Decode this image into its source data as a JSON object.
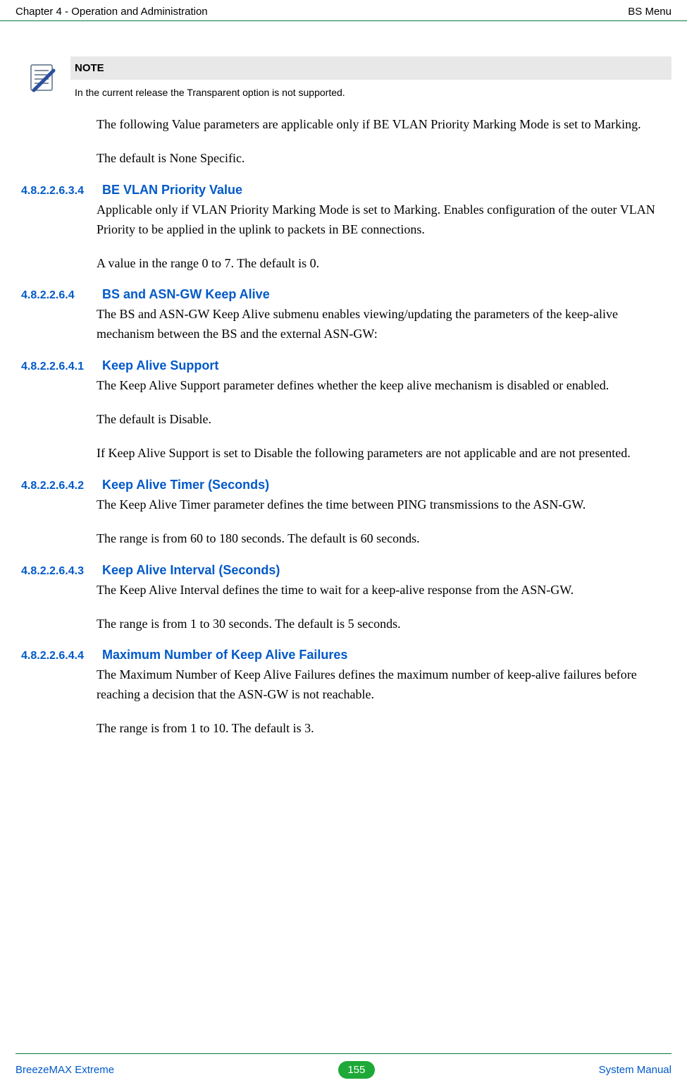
{
  "header": {
    "left": "Chapter 4 - Operation and Administration",
    "right": "BS Menu"
  },
  "note": {
    "label": "NOTE",
    "text": "In the current release the Transparent option is not supported."
  },
  "intro": [
    "The following Value parameters are applicable only if BE VLAN Priority Marking Mode is set to Marking.",
    "The default is None Specific."
  ],
  "sections": [
    {
      "num": "4.8.2.2.6.3.4",
      "title": "BE VLAN Priority Value",
      "paras": [
        "Applicable only if VLAN Priority Marking Mode is set to Marking. Enables configuration of the outer VLAN Priority to be applied in the uplink to packets in BE connections.",
        "A value in the range 0 to 7. The default is 0."
      ]
    },
    {
      "num": "4.8.2.2.6.4",
      "title": "BS and ASN-GW Keep Alive",
      "paras": [
        "The BS and ASN-GW Keep Alive submenu enables viewing/updating the parameters of the keep-alive mechanism between the BS and the external ASN-GW:"
      ]
    },
    {
      "num": "4.8.2.2.6.4.1",
      "title": "Keep Alive Support",
      "paras": [
        "The Keep Alive Support parameter defines whether the keep alive mechanism is disabled or enabled.",
        "The default is Disable.",
        "If Keep Alive Support is set to Disable the following parameters are not applicable and are not presented."
      ]
    },
    {
      "num": "4.8.2.2.6.4.2",
      "title": "Keep Alive Timer (Seconds)",
      "paras": [
        "The Keep Alive Timer parameter defines the time between PING transmissions to the ASN-GW.",
        "The range is from 60 to 180 seconds. The default is 60 seconds."
      ]
    },
    {
      "num": "4.8.2.2.6.4.3",
      "title": "Keep Alive Interval (Seconds)",
      "paras": [
        "The Keep Alive Interval defines the time to wait for a keep-alive response from the ASN-GW.",
        "The range is from 1 to 30 seconds. The default is 5 seconds."
      ]
    },
    {
      "num": "4.8.2.2.6.4.4",
      "title": "Maximum Number of Keep Alive Failures",
      "paras": [
        "The Maximum Number of Keep Alive Failures defines the maximum number of keep-alive failures before reaching a decision that the ASN-GW is not reachable.",
        "The range is from 1 to 10. The default is 3."
      ]
    }
  ],
  "footer": {
    "left": "BreezeMAX Extreme",
    "page": "155",
    "right": "System Manual"
  }
}
